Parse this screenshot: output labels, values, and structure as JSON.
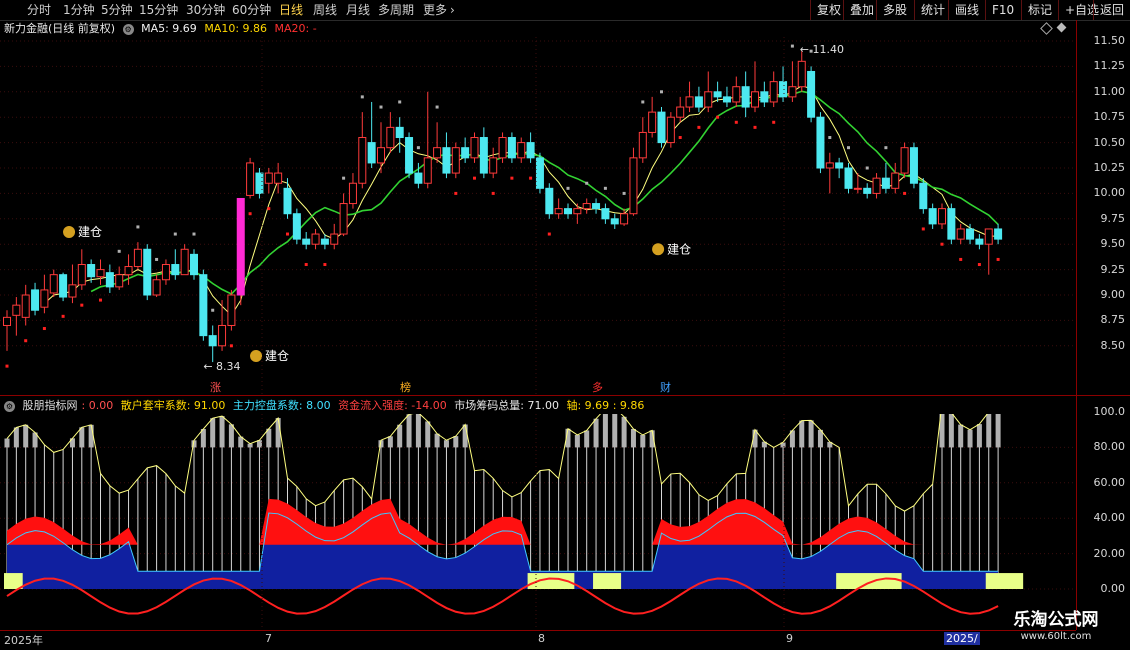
{
  "toolbar": {
    "periods": [
      "分时",
      "1分钟",
      "5分钟",
      "15分钟",
      "30分钟",
      "60分钟",
      "日线",
      "周线",
      "月线",
      "多周期",
      "更多"
    ],
    "active": "日线",
    "more_arrow": "›",
    "right_buttons": [
      "复权",
      "叠加",
      "多股",
      "统计",
      "画线",
      "F10",
      "标记",
      "+自选",
      "返回"
    ]
  },
  "stock": {
    "name": "新力金融(日线 前复权)",
    "ma5_label": "MA5: 9.69",
    "ma10_label": "MA10: 9.86",
    "ma20_label": "MA20: -"
  },
  "indicator": {
    "name": "股朋指标网",
    "zero": ": 0.00",
    "retail": "散户套牢系数: 91.00",
    "main": "主力控盘系数: 8.00",
    "flow": "资金流入强度: -14.00",
    "chips": "市场筹码总量: 71.00",
    "axis_a": "轴: 9.69",
    "axis_b": ": 9.86"
  },
  "colors": {
    "up": "#ff3b3b",
    "down": "#4de8f0",
    "ma5": "#ffffff",
    "ma10": "#ffd700",
    "ma20": "#ff3030",
    "ma_green": "#32d232",
    "border": "#8b0000"
  },
  "price_axis": [
    "11.50",
    "11.25",
    "11.00",
    "10.75",
    "10.50",
    "10.25",
    "10.00",
    "9.75",
    "9.50",
    "9.25",
    "9.00",
    "8.75",
    "8.50"
  ],
  "ind_axis": [
    "100.0",
    "80.00",
    "60.00",
    "40.00",
    "20.00",
    "0.00"
  ],
  "annotations": {
    "high": "11.40",
    "low": "8.34",
    "build": "建仓"
  },
  "events": [
    "涨",
    "榜",
    "多",
    "财"
  ],
  "time_axis": [
    "2025年",
    "7",
    "8",
    "9",
    "2025/"
  ],
  "watermark": {
    "title": "乐淘公式网",
    "url": "www.60lt.com"
  },
  "candles": [
    [
      8.7,
      8.78,
      8.45,
      8.85
    ],
    [
      8.8,
      8.9,
      8.6,
      8.98
    ],
    [
      8.78,
      9.0,
      8.7,
      9.1
    ],
    [
      9.05,
      8.85,
      8.8,
      9.12
    ],
    [
      8.88,
      9.05,
      8.82,
      9.2
    ],
    [
      9.02,
      9.2,
      8.98,
      9.25
    ],
    [
      9.2,
      8.98,
      8.94,
      9.22
    ],
    [
      8.98,
      9.1,
      8.92,
      9.3
    ],
    [
      9.1,
      9.3,
      9.05,
      9.45
    ],
    [
      9.3,
      9.18,
      9.12,
      9.35
    ],
    [
      9.18,
      9.25,
      9.1,
      9.35
    ],
    [
      9.22,
      9.08,
      9.02,
      9.3
    ],
    [
      9.08,
      9.2,
      9.05,
      9.28
    ],
    [
      9.2,
      9.28,
      9.1,
      9.4
    ],
    [
      9.28,
      9.45,
      9.25,
      9.52
    ],
    [
      9.45,
      9.0,
      8.95,
      9.5
    ],
    [
      9.0,
      9.15,
      8.98,
      9.2
    ],
    [
      9.15,
      9.3,
      9.1,
      9.35
    ],
    [
      9.3,
      9.2,
      9.15,
      9.45
    ],
    [
      9.2,
      9.45,
      9.2,
      9.5
    ],
    [
      9.4,
      9.2,
      9.15,
      9.45
    ],
    [
      9.2,
      8.6,
      8.55,
      9.25
    ],
    [
      8.6,
      8.5,
      8.34,
      8.7
    ],
    [
      8.5,
      8.7,
      8.45,
      8.95
    ],
    [
      8.7,
      9.0,
      8.65,
      9.05
    ],
    [
      9.0,
      9.95,
      8.9,
      9.95
    ],
    [
      9.98,
      10.3,
      9.95,
      10.35
    ],
    [
      10.2,
      10.0,
      9.95,
      10.25
    ],
    [
      10.1,
      10.2,
      10.0,
      10.25
    ],
    [
      10.1,
      10.2,
      10.0,
      10.3
    ],
    [
      10.05,
      9.8,
      9.75,
      10.15
    ],
    [
      9.8,
      9.55,
      9.5,
      9.85
    ],
    [
      9.55,
      9.5,
      9.45,
      9.62
    ],
    [
      9.5,
      9.6,
      9.45,
      9.65
    ],
    [
      9.55,
      9.5,
      9.45,
      9.6
    ],
    [
      9.5,
      9.6,
      9.45,
      9.7
    ],
    [
      9.6,
      9.9,
      9.58,
      10.0
    ],
    [
      9.9,
      10.1,
      9.85,
      10.2
    ],
    [
      10.1,
      10.55,
      10.05,
      10.8
    ],
    [
      10.5,
      10.3,
      10.25,
      10.9
    ],
    [
      10.3,
      10.45,
      10.2,
      10.7
    ],
    [
      10.45,
      10.65,
      10.4,
      10.8
    ],
    [
      10.65,
      10.55,
      10.4,
      10.75
    ],
    [
      10.55,
      10.2,
      10.15,
      10.6
    ],
    [
      10.2,
      10.1,
      10.05,
      10.3
    ],
    [
      10.1,
      10.35,
      10.05,
      11.0
    ],
    [
      10.35,
      10.45,
      10.3,
      10.7
    ],
    [
      10.45,
      10.2,
      10.15,
      10.6
    ],
    [
      10.2,
      10.45,
      10.15,
      10.5
    ],
    [
      10.45,
      10.35,
      10.3,
      10.55
    ],
    [
      10.35,
      10.55,
      10.3,
      10.6
    ],
    [
      10.55,
      10.2,
      10.15,
      10.65
    ],
    [
      10.2,
      10.35,
      10.15,
      10.45
    ],
    [
      10.35,
      10.55,
      10.3,
      10.6
    ],
    [
      10.55,
      10.35,
      10.3,
      10.6
    ],
    [
      10.35,
      10.5,
      10.3,
      10.55
    ],
    [
      10.5,
      10.35,
      10.3,
      10.6
    ],
    [
      10.35,
      10.05,
      10.0,
      10.4
    ],
    [
      10.05,
      9.8,
      9.75,
      10.1
    ],
    [
      9.8,
      9.85,
      9.75,
      9.95
    ],
    [
      9.85,
      9.8,
      9.75,
      9.9
    ],
    [
      9.8,
      9.85,
      9.7,
      9.9
    ],
    [
      9.85,
      9.9,
      9.8,
      9.95
    ],
    [
      9.9,
      9.85,
      9.8,
      9.95
    ],
    [
      9.85,
      9.75,
      9.7,
      9.9
    ],
    [
      9.75,
      9.7,
      9.65,
      9.8
    ],
    [
      9.7,
      9.8,
      9.68,
      9.85
    ],
    [
      9.8,
      10.35,
      9.78,
      10.45
    ],
    [
      10.35,
      10.6,
      10.3,
      10.75
    ],
    [
      10.6,
      10.8,
      10.55,
      10.95
    ],
    [
      10.8,
      10.5,
      10.45,
      10.85
    ],
    [
      10.5,
      10.75,
      10.45,
      10.8
    ],
    [
      10.75,
      10.85,
      10.7,
      10.95
    ],
    [
      10.85,
      10.95,
      10.8,
      11.1
    ],
    [
      10.95,
      10.85,
      10.8,
      11.05
    ],
    [
      10.85,
      11.0,
      10.8,
      11.2
    ],
    [
      11.0,
      10.95,
      10.9,
      11.1
    ],
    [
      10.95,
      10.9,
      10.85,
      11.05
    ],
    [
      10.9,
      11.05,
      10.85,
      11.15
    ],
    [
      11.05,
      10.85,
      10.75,
      11.2
    ],
    [
      10.85,
      11.0,
      10.8,
      11.3
    ],
    [
      11.0,
      10.9,
      10.85,
      11.1
    ],
    [
      10.9,
      11.1,
      10.85,
      11.2
    ],
    [
      11.1,
      10.95,
      10.9,
      11.25
    ],
    [
      10.95,
      11.05,
      10.9,
      11.3
    ],
    [
      11.05,
      11.3,
      11.0,
      11.4
    ],
    [
      11.2,
      10.75,
      10.7,
      11.25
    ],
    [
      10.75,
      10.25,
      10.2,
      10.8
    ],
    [
      10.25,
      10.3,
      10.0,
      10.4
    ],
    [
      10.3,
      10.25,
      10.15,
      10.35
    ],
    [
      10.25,
      10.05,
      10.0,
      10.3
    ],
    [
      10.05,
      10.05,
      10.0,
      10.2
    ],
    [
      10.05,
      10.0,
      9.95,
      10.1
    ],
    [
      10.0,
      10.15,
      9.95,
      10.2
    ],
    [
      10.15,
      10.05,
      10.0,
      10.3
    ],
    [
      10.05,
      10.2,
      10.0,
      10.3
    ],
    [
      10.2,
      10.45,
      10.15,
      10.5
    ],
    [
      10.45,
      10.1,
      10.05,
      10.5
    ],
    [
      10.1,
      9.85,
      9.8,
      10.15
    ],
    [
      9.85,
      9.7,
      9.65,
      9.9
    ],
    [
      9.7,
      9.85,
      9.65,
      9.9
    ],
    [
      9.85,
      9.55,
      9.5,
      9.9
    ],
    [
      9.55,
      9.65,
      9.5,
      9.7
    ],
    [
      9.65,
      9.55,
      9.5,
      9.7
    ],
    [
      9.55,
      9.5,
      9.45,
      9.6
    ],
    [
      9.5,
      9.65,
      9.2,
      9.65
    ],
    [
      9.65,
      9.55,
      9.5,
      9.7
    ]
  ]
}
